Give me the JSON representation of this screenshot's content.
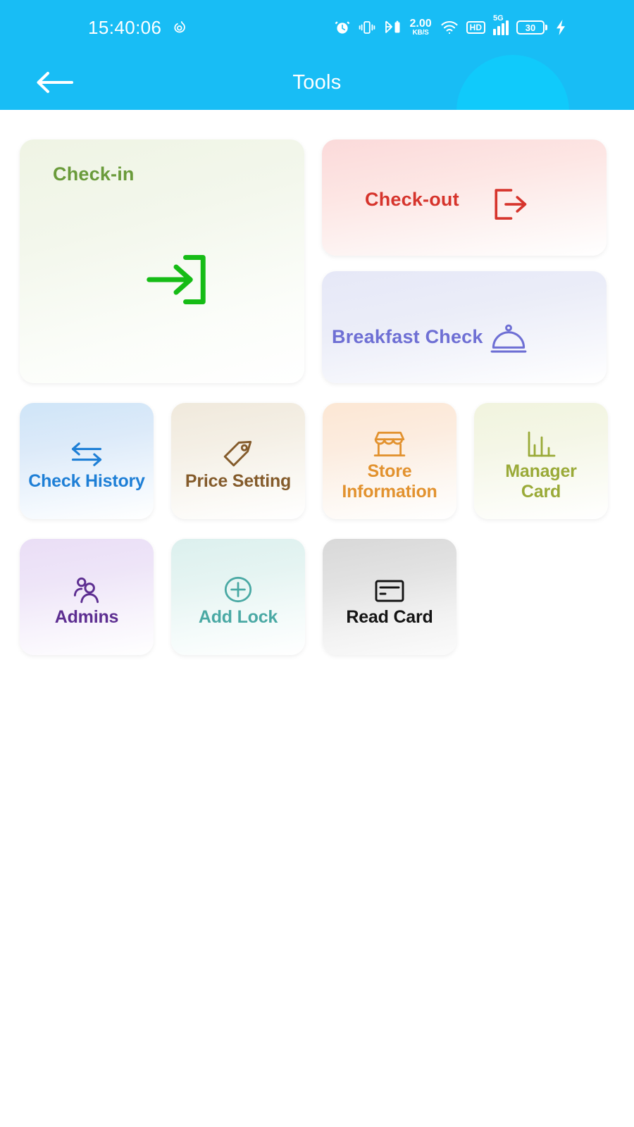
{
  "status_bar": {
    "time": "15:40:06",
    "music_icon": "netease-music-icon",
    "icons": [
      "alarm-clock-icon",
      "vibrate-icon",
      "bluetooth-battery-icon",
      "network-speed-icon",
      "wifi-icon",
      "hd-badge-icon",
      "signal-5g-icon",
      "battery-icon",
      "charging-bolt-icon"
    ],
    "network_speed_value": "2.00",
    "network_speed_unit": "KB/S",
    "hd_label": "HD",
    "signal_label": "5G",
    "battery_level": "30"
  },
  "navbar": {
    "back_icon": "back-arrow-icon",
    "title": "Tools"
  },
  "colors": {
    "header": "#18bdf5",
    "header_blob": "#0fcdfb",
    "checkin": "#6a9b3a",
    "checkin_icon": "#16bc16",
    "checkout": "#d6342c",
    "breakfast": "#6e6fd4",
    "check_history": "#1e7fd6",
    "price_setting": "#845b2b",
    "store_information": "#e2922f",
    "manager_card": "#9aaa38",
    "admins": "#5d2e91",
    "add_lock": "#4aa9a4",
    "read_card": "#141414"
  },
  "tools": {
    "checkin": {
      "label": "Check-in",
      "icon": "login-arrow-icon"
    },
    "checkout": {
      "label": "Check-out",
      "icon": "logout-arrow-icon"
    },
    "breakfast": {
      "label": "Breakfast Check",
      "icon": "food-dome-icon"
    },
    "grid": [
      {
        "label": "Check History",
        "icon": "swap-arrows-icon"
      },
      {
        "label": "Price Setting",
        "icon": "price-tag-icon"
      },
      {
        "label": "Store\nInformation",
        "icon": "storefront-icon"
      },
      {
        "label": "Manager\nCard",
        "icon": "bar-chart-icon"
      },
      {
        "label": "Admins",
        "icon": "users-icon"
      },
      {
        "label": "Add Lock",
        "icon": "plus-circle-icon"
      },
      {
        "label": "Read Card",
        "icon": "credit-card-icon"
      }
    ]
  }
}
